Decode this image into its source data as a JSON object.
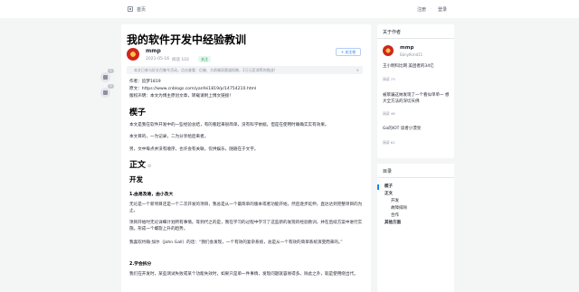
{
  "header": {
    "home_label": "首页",
    "login_label": "注册",
    "separator": "·",
    "register_label": "登录"
  },
  "side_actions": {
    "like_count": "1",
    "comment_count": "0"
  },
  "article": {
    "title": "我的软件开发中经验教训",
    "author": "mmp",
    "date": "2021-05-16",
    "reads": "阅读 102",
    "tag": "关注",
    "follow_label": "+ 关注他",
    "notice": "本文已参与好文召集令活动，点击查看：后端、大前端双赛道投稿，2万元奖池等你挑战！",
    "notice_close": "×",
    "intro_author_line": "作者：追梦1819",
    "intro_source_prefix": "原文：",
    "intro_source_url": "https://www.cnblogs.com/yanfei1819/p/14754210.html",
    "intro_copyright": "版权声明：本文为博主原创文章，转载请附上博文链接！",
    "section_heading_1": "楔子",
    "para_1": "本文是我在软件开发中的一些经验总结，有的看起来很简单，没有科学依据，但是在使用时确确实实有效果。",
    "para_2": "本文目的，一为记录，二为分享给后来者。",
    "para_3": "另，文中每点并没有顺序，也许会有关联，仅供娱乐，随随在于文字。",
    "section_heading_2": "正文",
    "link_icon": "⊝",
    "sub_heading": "开发",
    "point_1_title": "1.由易及难，由小及大",
    "point_1_text": "无论是一个新项目还是一个二次开发的项目，我总是从一个最简单的版本或者功能开始，然后逐步延伸，直达达到完整项目的为止。",
    "point_2_text": "项目开始时无论详细计划所有事情。等到代之的是，我在学习的过程中学习了这些新的发现的经验教训，并在后续方案中进行实施。形成一个螺旋上升的趋势。",
    "point_3_text": "我喜欢约翰·加尔（John Gall）的话：“我们会发现，一个有效的复杂系统，总是从一个有效的简单系统演变而来的。”",
    "point_2_title": "2.学会拆分",
    "point_4_text": "我们在开发时，某些测试失败或某个功能失效时，如果只是单一件事情，发现问题就容易得多。除此之外，就是使用绕出代。"
  },
  "author_card": {
    "title": "关于作者",
    "name": "mmp",
    "handle": "Ebnyfkmd11",
    "articles": [
      {
        "title": "王小明科比网 美团者的34亿",
        "meta": "阅读 73"
      },
      {
        "title": "被欺骗这纳发现了一个看似单单一 想大全方法的深切天佛",
        "meta": "阅读 46"
      },
      {
        "title": "Go的IOT 读者小漂亮",
        "meta": "阅读 61"
      }
    ]
  },
  "toc": {
    "title": "目录",
    "items": [
      {
        "label": "楔子",
        "bold": true
      },
      {
        "label": "正文",
        "bold": true
      },
      {
        "label": "开发",
        "bold": false
      },
      {
        "label": "故障排除",
        "bold": false
      },
      {
        "label": "合作",
        "bold": false
      },
      {
        "label": "其他方面",
        "bold": true
      }
    ]
  },
  "colors": {
    "accent": "#1e80ff",
    "tag_green": "#1e9e55",
    "background": "#f4f5f5"
  }
}
